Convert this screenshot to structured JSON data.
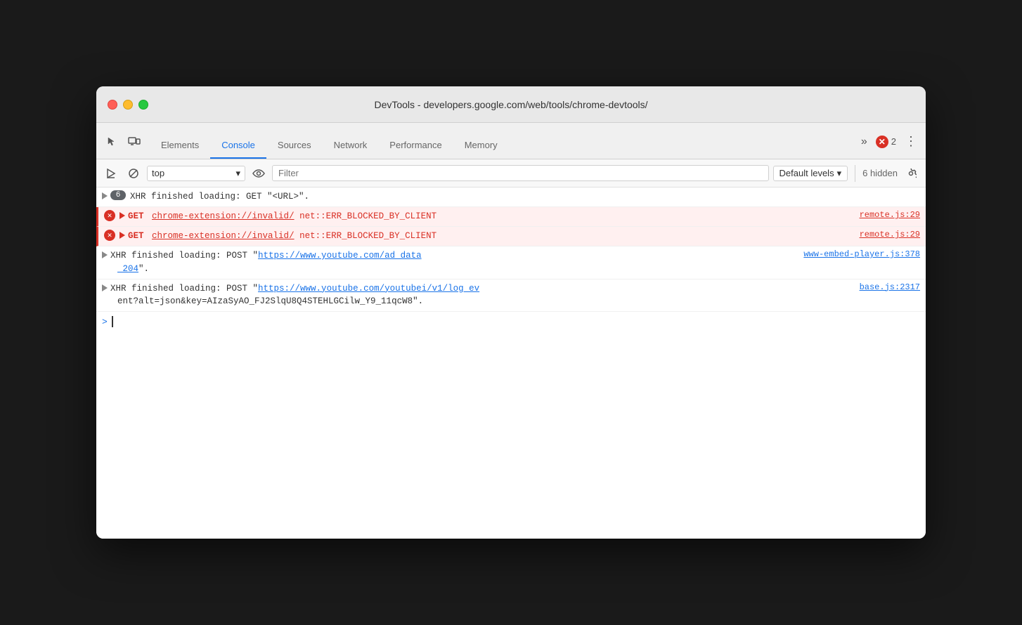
{
  "window": {
    "title": "DevTools - developers.google.com/web/tools/chrome-devtools/"
  },
  "traffic_lights": {
    "close": "close",
    "minimize": "minimize",
    "maximize": "maximize"
  },
  "tabs": [
    {
      "id": "elements",
      "label": "Elements",
      "active": false
    },
    {
      "id": "console",
      "label": "Console",
      "active": true
    },
    {
      "id": "sources",
      "label": "Sources",
      "active": false
    },
    {
      "id": "network",
      "label": "Network",
      "active": false
    },
    {
      "id": "performance",
      "label": "Performance",
      "active": false
    },
    {
      "id": "memory",
      "label": "Memory",
      "active": false
    }
  ],
  "tab_bar": {
    "more_label": "»",
    "error_count": "2",
    "menu_label": "⋮"
  },
  "console_toolbar": {
    "clear_label": "⊘",
    "context_value": "top",
    "context_arrow": "▾",
    "filter_placeholder": "Filter",
    "levels_label": "Default levels",
    "levels_arrow": "▾",
    "hidden_label": "6 hidden"
  },
  "log_entries": [
    {
      "id": "xhr1",
      "type": "info",
      "badge": "6",
      "text": "XHR finished loading: GET \"<URL>\".",
      "source_link": null
    },
    {
      "id": "err1",
      "type": "error",
      "method": "GET",
      "url": "chrome-extension://invalid/",
      "error_msg": "net::ERR_BLOCKED_BY_CLIENT",
      "source_link": "remote.js:29"
    },
    {
      "id": "err2",
      "type": "error",
      "method": "GET",
      "url": "chrome-extension://invalid/",
      "error_msg": "net::ERR_BLOCKED_BY_CLIENT",
      "source_link": "remote.js:29"
    },
    {
      "id": "xhr2",
      "type": "info_multi",
      "text_before": "XHR finished loading: POST \"",
      "link_text": "https://www.youtube.com/ad_data",
      "source_link": "www-embed-player.js:378",
      "source_link2": "_204",
      "text_after": "\"."
    },
    {
      "id": "xhr3",
      "type": "info_multi2",
      "text_before": "XHR finished loading: POST \"",
      "link_text": "https://www.youtube.com/youtubei/v1/log_ev",
      "source_link": "base.js:2317",
      "continuation": "ent?alt=json&key=AIzaSyAO_FJ2SlqU8Q4STEHLGCilw_Y9_11qcW8\""
    }
  ],
  "cursor": {
    "prompt": ">"
  }
}
